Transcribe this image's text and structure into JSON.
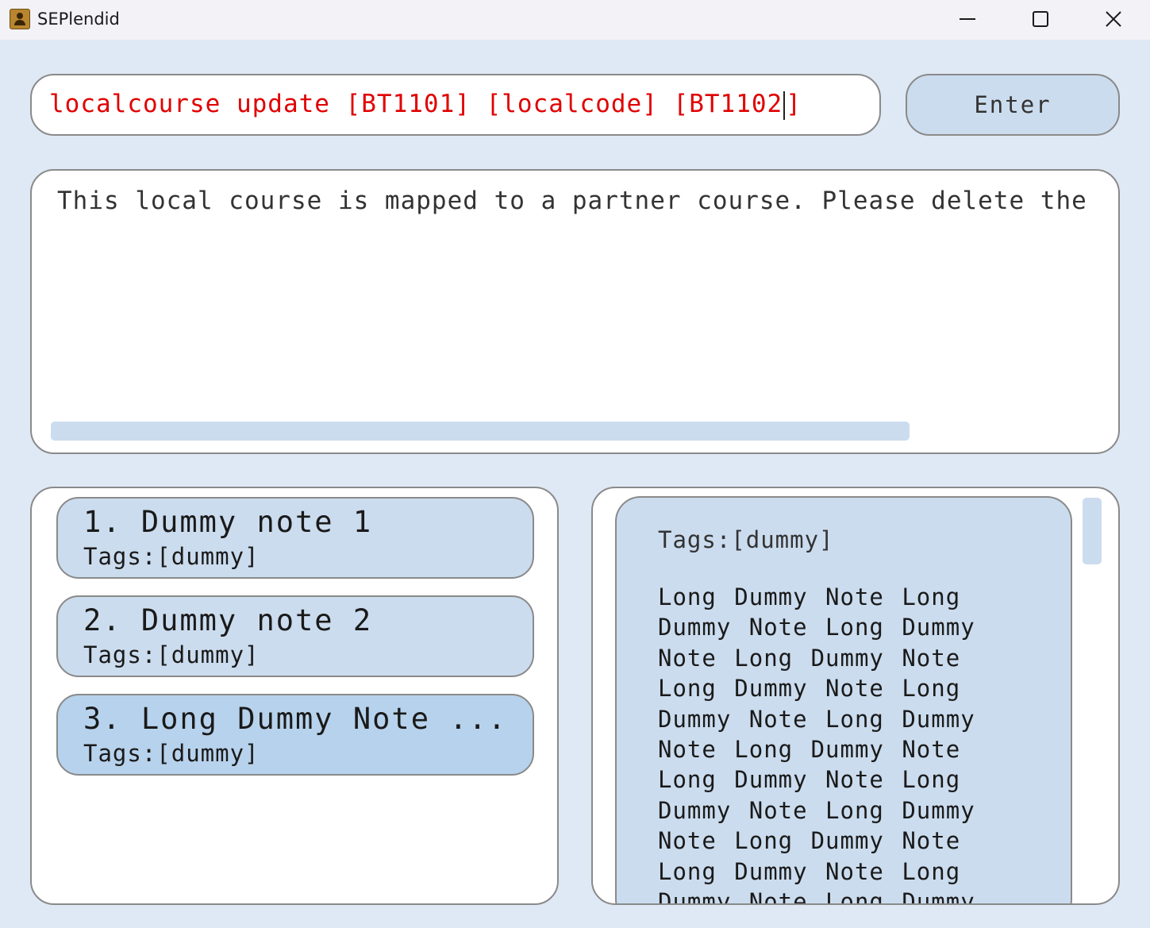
{
  "window": {
    "title": "SEPlendid",
    "app_icon": "address-book-icon",
    "controls": [
      "minimize-icon",
      "maximize-icon",
      "close-icon"
    ]
  },
  "command": {
    "value": "localcourse update [BT1101] [localcode] [BT1102",
    "value_after_caret": "]",
    "text_color": "#e00000"
  },
  "enter_button": {
    "label": "Enter"
  },
  "result": {
    "text": "This local course is mapped to a partner course. Please delete the"
  },
  "notes": {
    "items": [
      {
        "title": "1. Dummy note 1",
        "tags": "Tags:[dummy]"
      },
      {
        "title": "2. Dummy note 2",
        "tags": "Tags:[dummy]"
      },
      {
        "title": "3. Long Dummy Note ...",
        "tags": "Tags:[dummy]"
      }
    ],
    "selected_index": 2
  },
  "detail": {
    "tags": "Tags:[dummy]",
    "content": "Long Dummy Note Long Dummy Note Long Dummy Note Long Dummy Note Long Dummy Note Long Dummy Note Long Dummy Note Long Dummy Note Long Dummy Note Long Dummy Note Long Dummy Note Long Dummy Note Long Dummy Note Long Dummy Note Long Dummy"
  },
  "colors": {
    "background": "#dfe9f5",
    "card": "#cbdcee",
    "card_selected": "#b7d2ec",
    "border": "#8a8a8a",
    "error_text": "#e00000"
  }
}
